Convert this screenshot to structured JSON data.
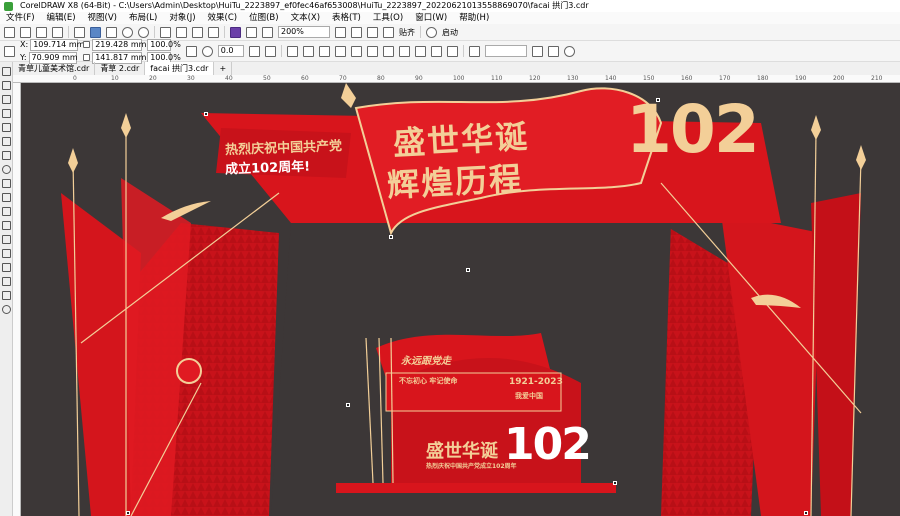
{
  "window": {
    "title": "CorelDRAW X8 (64-Bit) - C:\\Users\\Admin\\Desktop\\HuiTu_2223897_ef0fec46af653008\\HuiTu_2223897_20220621013558869070\\facai 拱门3.cdr"
  },
  "menu": [
    "文件(F)",
    "编辑(E)",
    "视图(V)",
    "布局(L)",
    "对象(J)",
    "效果(C)",
    "位图(B)",
    "文本(X)",
    "表格(T)",
    "工具(O)",
    "窗口(W)",
    "帮助(H)"
  ],
  "toolbar": {
    "zoom": "200%",
    "snap": "贴齐",
    "launch": "启动"
  },
  "props": {
    "x": "109.714 mm",
    "y": "70.909 mm",
    "w": "219.428 mm",
    "h": "141.817 mm",
    "scale_x": "100.0",
    "scale_y": "100.0",
    "pct": "%",
    "angle": "0.0",
    "x_label": "X:",
    "y_label": "Y:"
  },
  "tabs": [
    "青草儿童美术馆.cdr",
    "青草 2.cdr",
    "facai 拱门3.cdr"
  ],
  "ruler_ticks": [
    "0",
    "10",
    "20",
    "30",
    "40",
    "50",
    "60",
    "70",
    "80",
    "90",
    "100",
    "110",
    "120",
    "130",
    "140",
    "150",
    "160",
    "170",
    "180",
    "190",
    "200",
    "210",
    "220"
  ],
  "artwork": {
    "headline_1": "盛世华诞",
    "headline_2": "辉煌历程",
    "number": "102",
    "slogan_1": "热烈庆祝中国共产党",
    "slogan_2": "成立102周年!",
    "small_flag": "永远跟党走",
    "small_sub": "不忘初心 牢记使命",
    "small_years": "1921-2023",
    "small_years_sub": "我爱中国",
    "small_headline": "盛世华诞",
    "small_number": "102",
    "small_caption": "热烈庆祝中国共产党成立102周年"
  },
  "colors": {
    "bg": "#3c3737",
    "red": "#d8151c",
    "dark_red": "#a90f14",
    "gold": "#f3cf98"
  }
}
